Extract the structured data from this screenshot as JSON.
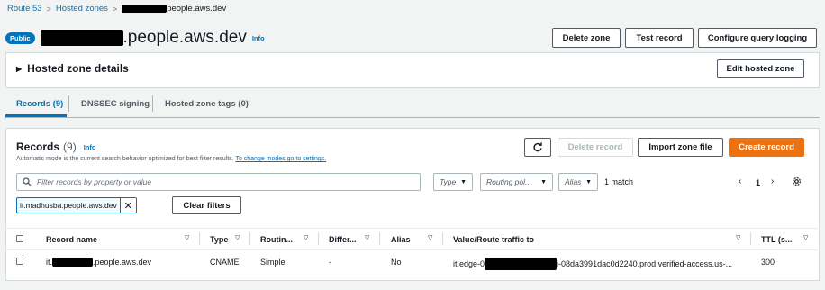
{
  "breadcrumb": {
    "route53": "Route 53",
    "hosted_zones": "Hosted zones",
    "current_suffix": "people.aws.dev"
  },
  "header": {
    "badge": "Public",
    "title_suffix": ".people.aws.dev",
    "info": "Info",
    "buttons": {
      "delete_zone": "Delete zone",
      "test_record": "Test record",
      "configure_query_logging": "Configure query logging"
    }
  },
  "hosted_zone_details": {
    "title": "Hosted zone details",
    "edit_button": "Edit hosted zone"
  },
  "tabs": [
    {
      "label": "Records (9)",
      "active": true
    },
    {
      "label": "DNSSEC signing",
      "active": false
    },
    {
      "label": "Hosted zone tags (0)",
      "active": false
    }
  ],
  "records": {
    "title": "Records",
    "count": "(9)",
    "info": "Info",
    "subtitle": "Automatic mode is the current search behavior optimized for best filter results.",
    "subtitle_link": "To change modes go to settings.",
    "buttons": {
      "delete_record": "Delete record",
      "import_zone_file": "Import zone file",
      "create_record": "Create record",
      "clear_filters": "Clear filters"
    },
    "filter": {
      "placeholder": "Filter records by property or value",
      "type": "Type",
      "routing_policy": "Routing pol...",
      "alias": "Alias",
      "match_count": "1 match",
      "token": "it.madhusba.people.aws.dev"
    },
    "pagination": {
      "page": "1"
    },
    "columns": [
      "Record name",
      "Type",
      "Routin...",
      "Differ...",
      "Alias",
      "Value/Route traffic to",
      "TTL (s..."
    ],
    "rows": [
      {
        "record_name_prefix": "it.",
        "record_name_suffix": ".people.aws.dev",
        "type": "CNAME",
        "routing": "Simple",
        "differentiator": "-",
        "alias": "No",
        "value_prefix": "it.edge-0",
        "value_suffix": "i-08da3991dac0d2240.prod.verified-access.us-...",
        "ttl": "300"
      }
    ]
  },
  "colors": {
    "link": "#0073bb",
    "primary": "#ec7211",
    "border": "#d5dbdb"
  },
  "icons": [
    "chevron-right-icon",
    "caret-right-icon",
    "refresh-icon",
    "search-icon",
    "close-icon",
    "chevron-left-icon",
    "settings-icon",
    "filter-icon"
  ]
}
